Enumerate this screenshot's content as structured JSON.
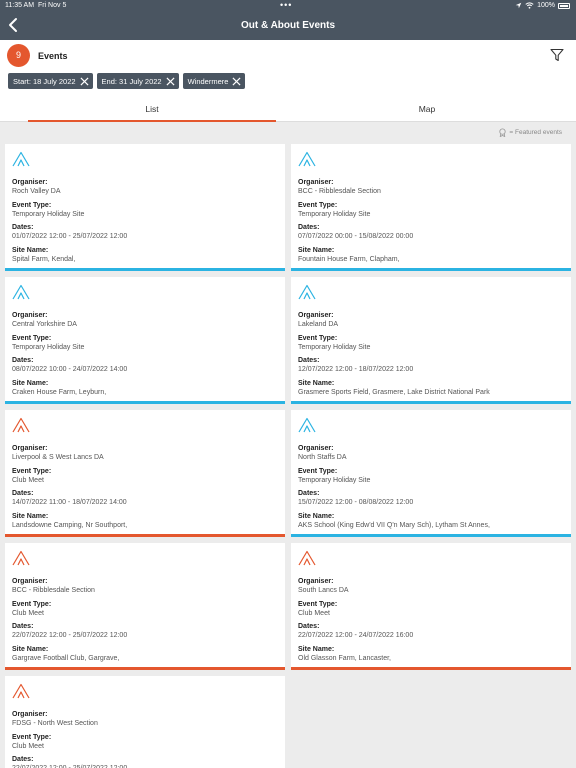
{
  "status": {
    "time": "11:35 AM",
    "day": "Fri Nov 5",
    "battery": "100%"
  },
  "header": {
    "title": "Out & About Events"
  },
  "filter": {
    "count": "9",
    "label": "Events",
    "chips": [
      "Start: 18 July 2022",
      "End: 31 July 2022",
      "Windermere"
    ]
  },
  "tabs": {
    "list": "List",
    "map": "Map"
  },
  "featured_legend": "= Featured events",
  "field_labels": {
    "organiser": "Organiser:",
    "type": "Event Type:",
    "dates": "Dates:",
    "site": "Site Name:"
  },
  "colors": {
    "holiday_site": "#2bb3e2",
    "club_meet": "#e4572e",
    "header": "#4a5561"
  },
  "events": [
    {
      "organiser": "Roch Valley DA",
      "type": "Temporary Holiday Site",
      "dates": "01/07/2022 12:00 - 25/07/2022 12:00",
      "site": "Spital Farm, Kendal,"
    },
    {
      "organiser": "BCC - Ribblesdale Section",
      "type": "Temporary Holiday Site",
      "dates": "07/07/2022 00:00 - 15/08/2022 00:00",
      "site": "Fountain House Farm, Clapham,"
    },
    {
      "organiser": "Central Yorkshire DA",
      "type": "Temporary Holiday Site",
      "dates": "08/07/2022 10:00 - 24/07/2022 14:00",
      "site": "Craken House Farm, Leyburn,"
    },
    {
      "organiser": "Lakeland DA",
      "type": "Temporary Holiday Site",
      "dates": "12/07/2022 12:00 - 18/07/2022 12:00",
      "site": "Grasmere Sports Field, Grasmere, Lake District National Park"
    },
    {
      "organiser": "Liverpool & S West Lancs DA",
      "type": "Club Meet",
      "dates": "14/07/2022 11:00 - 18/07/2022 14:00",
      "site": "Landsdowne Camping, Nr Southport,"
    },
    {
      "organiser": "North Staffs DA",
      "type": "Temporary Holiday Site",
      "dates": "15/07/2022 12:00 - 08/08/2022 12:00",
      "site": "AKS School (King Edw'd VII Q'n Mary Sch), Lytham St Annes,"
    },
    {
      "organiser": "BCC - Ribblesdale Section",
      "type": "Club Meet",
      "dates": "22/07/2022 12:00 - 25/07/2022 12:00",
      "site": "Gargrave Football Club, Gargrave,"
    },
    {
      "organiser": "South Lancs DA",
      "type": "Club Meet",
      "dates": "22/07/2022 12:00 - 24/07/2022 16:00",
      "site": "Old Glasson Farm, Lancaster,"
    },
    {
      "organiser": "FDSG - North West Section",
      "type": "Club Meet",
      "dates": "22/07/2022 12:00 - 25/07/2022 12:00",
      "site": ""
    }
  ]
}
